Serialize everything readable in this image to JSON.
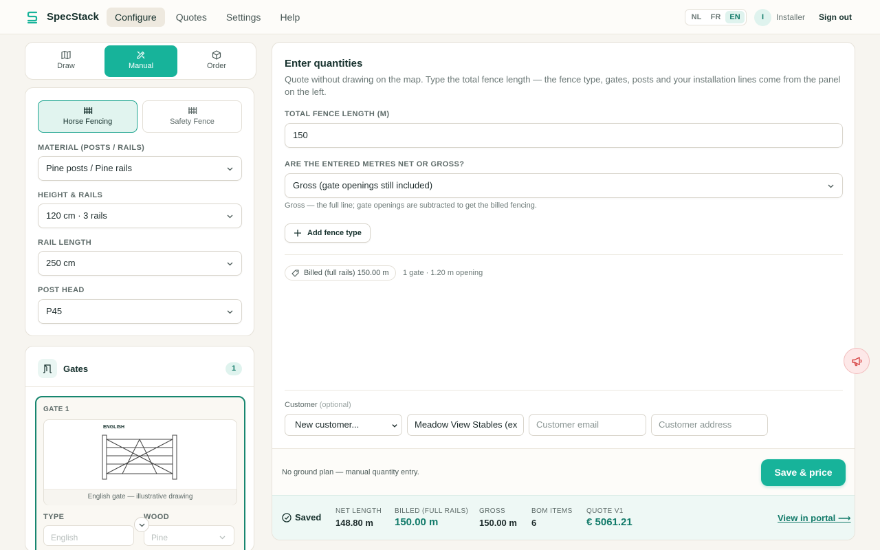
{
  "app": {
    "name": "SpecStack"
  },
  "nav": {
    "items": [
      "Configure",
      "Quotes",
      "Settings",
      "Help"
    ],
    "active": "Configure"
  },
  "languages": {
    "items": [
      "NL",
      "FR",
      "EN"
    ],
    "active": "EN"
  },
  "user": {
    "initial": "I",
    "role": "Installer",
    "signout": "Sign out"
  },
  "modes": {
    "items": [
      "Draw",
      "Manual",
      "Order"
    ],
    "active": "Manual"
  },
  "fence_types": {
    "items": [
      "Horse Fencing",
      "Safety Fence"
    ],
    "active": "Horse Fencing"
  },
  "config": {
    "material": {
      "label": "MATERIAL (POSTS / RAILS)",
      "value": "Pine posts / Pine rails"
    },
    "height": {
      "label": "HEIGHT & RAILS",
      "value": "120 cm · 3 rails"
    },
    "rail_length": {
      "label": "RAIL LENGTH",
      "value": "250 cm"
    },
    "post_head": {
      "label": "POST HEAD",
      "value": "P45"
    }
  },
  "gates": {
    "title": "Gates",
    "count": "1",
    "gate1": {
      "label": "GATE 1",
      "drawing_title": "ENGLISH",
      "caption": "English gate — illustrative drawing",
      "type_label": "TYPE",
      "type_value": "English",
      "wood_label": "WOOD",
      "wood_value": "Pine"
    }
  },
  "main": {
    "title": "Enter quantities",
    "description": "Quote without drawing on the map. Type the total fence length — the fence type, gates, posts and your installation lines come from the panel on the left.",
    "length_label": "TOTAL FENCE LENGTH (M)",
    "length_value": "150",
    "netgross_label": "ARE THE ENTERED METRES NET OR GROSS?",
    "netgross_value": "Gross (gate openings still included)",
    "netgross_hint": "Gross — the full line; gate openings are subtracted to get the billed fencing.",
    "add_fence_type": "Add fence type",
    "billed_pill": "Billed (full rails) 150.00 m",
    "gate_note": "1 gate · 1.20 m opening"
  },
  "customer": {
    "label": "Customer",
    "optional": "(optional)",
    "select_value": "New customer...",
    "name_value": "Meadow View Stables (ex",
    "email_placeholder": "Customer email",
    "address_placeholder": "Customer address"
  },
  "plan": {
    "note": "No ground plan — manual quantity entry.",
    "save_label": "Save & price"
  },
  "summary": {
    "saved": "Saved",
    "net_label": "NET LENGTH",
    "net_value": "148.80 m",
    "billed_label": "BILLED (FULL RAILS)",
    "billed_value": "150.00 m",
    "gross_label": "GROSS",
    "gross_value": "150.00 m",
    "bom_label": "BOM ITEMS",
    "bom_value": "6",
    "quote_label": "QUOTE V1",
    "quote_value": "€ 5061.21",
    "portal_link": "View in portal ⟶"
  },
  "colors": {
    "accent": "#17b39a",
    "accent_dark": "#117a69",
    "background": "#f7f5f0"
  }
}
